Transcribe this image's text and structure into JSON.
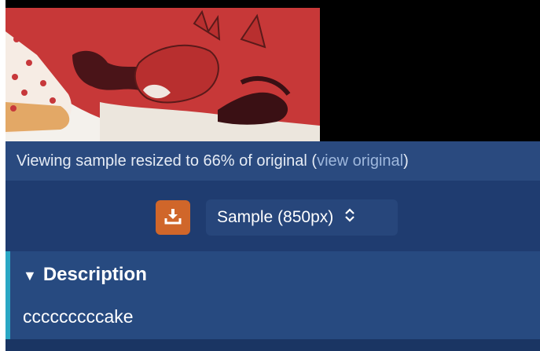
{
  "post": {
    "image_alt": "sample image",
    "resize_notice": {
      "prefix": "Viewing sample resized to 66% of original (",
      "link_text": "view original",
      "suffix": ")"
    }
  },
  "toolbar": {
    "download_icon": "download-icon",
    "size_select_value": "Sample (850px)",
    "size_select_icon": "chevron-up-down-icon"
  },
  "description": {
    "toggle_icon": "triangle-down-icon",
    "title": "Description",
    "body": "cccccccccake"
  },
  "colors": {
    "accent_orange": "#d0662a",
    "panel_blue": "#274a80",
    "accent_teal": "#2aa7c4"
  }
}
